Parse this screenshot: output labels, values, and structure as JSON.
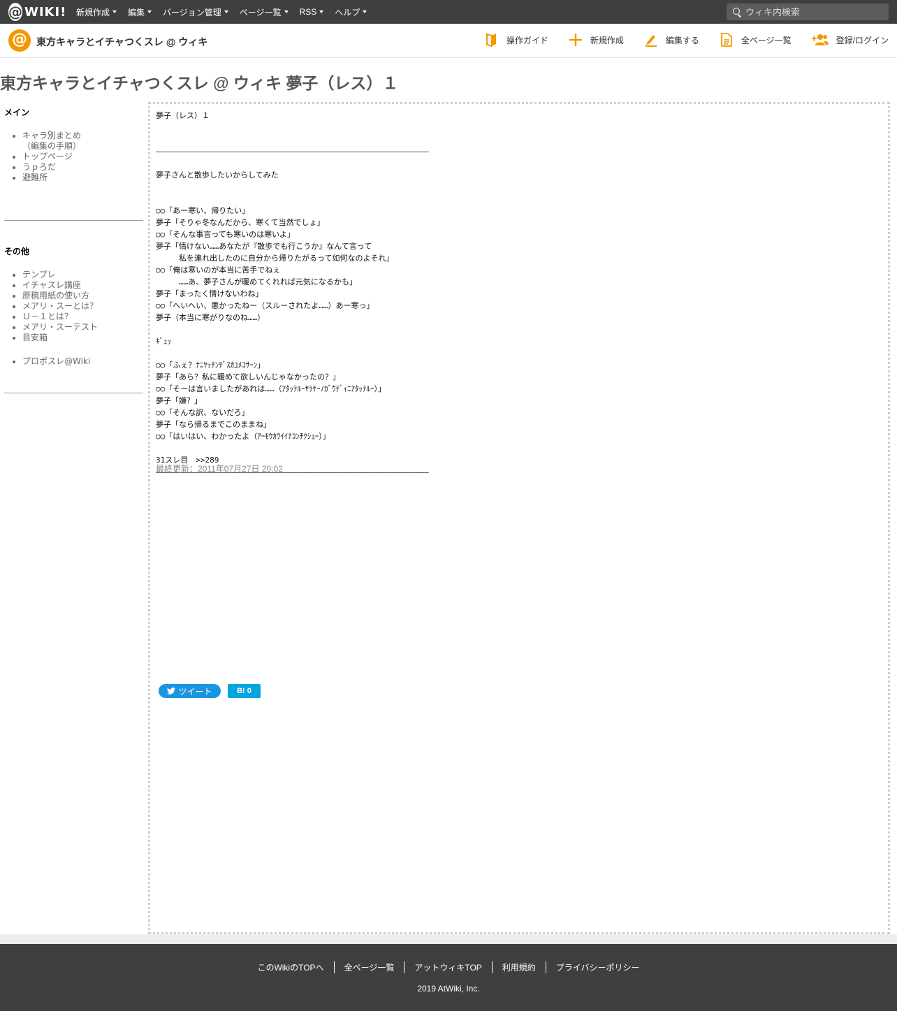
{
  "topbar": {
    "logo": "WIKI!",
    "menu": [
      "新規作成",
      "編集",
      "バージョン管理",
      "ページ一覧",
      "RSS",
      "ヘルプ"
    ],
    "search_placeholder": "ウィキ内検索"
  },
  "header": {
    "wiki_name": "東方キャラとイチャつくスレ @ ウィキ",
    "actions": [
      "操作ガイド",
      "新規作成",
      "編集する",
      "全ページ一覧",
      "登録/ログイン"
    ]
  },
  "page": {
    "title": "東方キャラとイチャつくスレ @ ウィキ 夢子（レス）１",
    "body": "夢子（レス）１\n\n\n―――――――――――――――――――――――――――――――――――――――――――――――――――――――――――\n\n夢子さんと散歩したいからしてみた\n\n\n○○「あー寒い、帰りたい」\n夢子「そりゃ冬なんだから、寒くて当然でしょ」\n○○「そんな事言っても寒いのは寒いよ」\n夢子「情けない……あなたが『散歩でも行こうか』なんて言って\n　　　私を連れ出したのに自分から帰りたがるって如何なのよそれ」\n○○「俺は寒いのが本当に苦手でねぇ\n　　　……あ、夢子さんが暖めてくれれば元気になるかも」\n夢子「まったく情けないわね」\n○○「へいへい、悪かったねー（スルーされたよ……）あー寒っ」\n夢子（本当に寒がりなのね……）\n\nｷﾞｭｯ\n\n○○「ふぇ？ﾅﾆﾔｯﾃﾝﾃﾞｽｶﾕﾒｺｻｰﾝ」\n夢子「あら？私に暖めて欲しいんじゃなかったの？」\n○○「そーは言いましたがあれは……（ｱﾀｯﾃﾙｰﾔﾗｹｰﾉｶﾞｳﾃﾞｨﾆｱﾀｯﾃﾙｰ）」\n夢子「嫌？」\n○○「そんな訳、ないだろ」\n夢子「なら帰るまでこのままね」\n○○「はいはい、わかったよ（ｱｰﾓｳｶﾜｲｲﾅｺﾝﾁｸｼｮｰ）」\n\n31スレ目　>>289\n―――――――――――――――――――――――――――――――――――――――――――――――――――――――――――",
    "updated": "最終更新：2011年07月27日 20:02",
    "tweet_label": "ツイート",
    "hatena_label": "B! 0"
  },
  "sidebar": {
    "main_head": "メイン",
    "main_items": [
      "キャラ別まとめ",
      "トップページ",
      "うｐろだ",
      "避難所"
    ],
    "main_sub": "（編集の手順）",
    "other_head": "その他",
    "other_items": [
      "テンプレ",
      "イチャスレ講座",
      "原稿用紙の使い方",
      "メアリ・スーとは？",
      "Ｕ－１とは？",
      "メアリ・スーテスト",
      "目安箱"
    ],
    "extra_item": "プロポスレ@Wiki"
  },
  "footer": {
    "links": [
      "このWikiのTOPへ",
      "全ページ一覧",
      "アットウィキTOP",
      "利用規約",
      "プライバシーポリシー"
    ],
    "copyright": "2019 AtWiki, Inc."
  }
}
